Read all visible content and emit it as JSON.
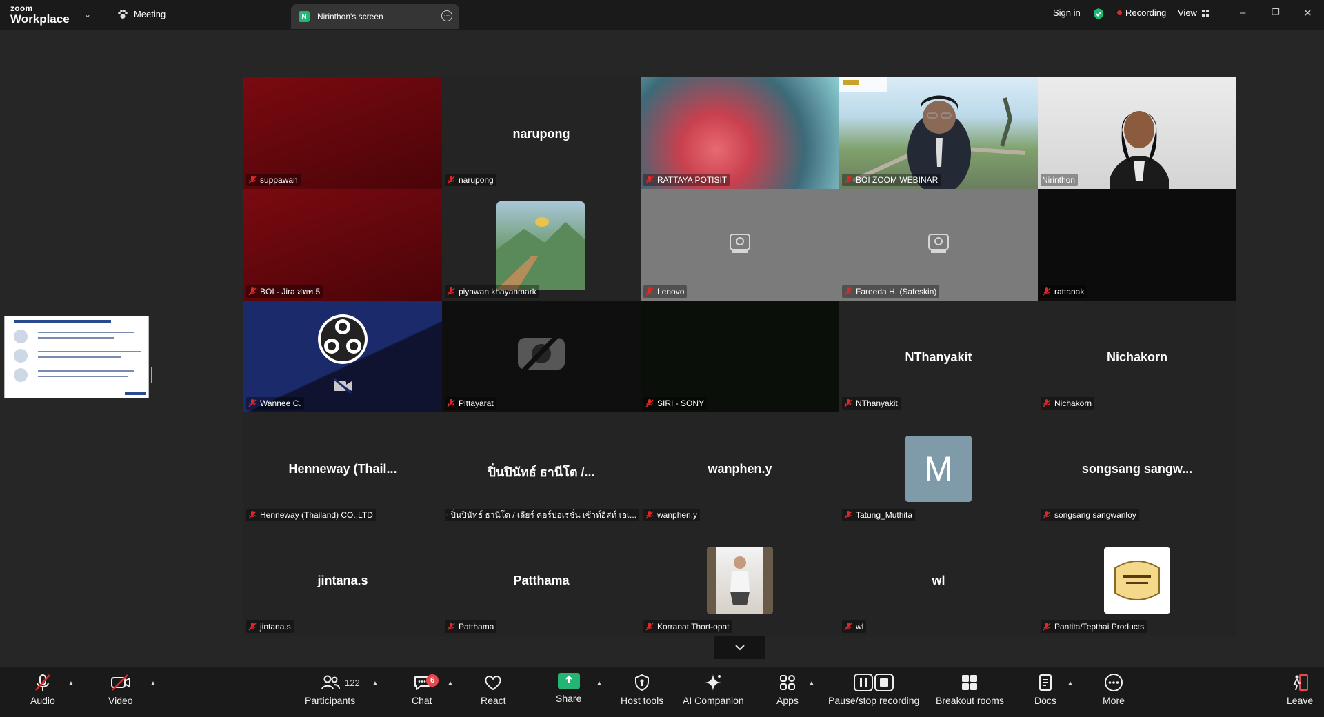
{
  "titlebar": {
    "logo_top": "zoom",
    "logo_bottom": "Workplace",
    "meeting_label": "Meeting",
    "screen_badge": "N",
    "screen_tab": "Nirinthon's screen",
    "signin": "Sign in",
    "recording": "Recording",
    "view": "View"
  },
  "gallery": {
    "tiles": [
      {
        "label": "suppawan",
        "center": ""
      },
      {
        "label": "narupong",
        "center": "narupong"
      },
      {
        "label": "RATTAYA POTISIT",
        "center": ""
      },
      {
        "label": "BOI ZOOM WEBINAR",
        "center": ""
      },
      {
        "label": "Nirinthon",
        "center": ""
      },
      {
        "label": "BOI - Jira สทท.5",
        "center": ""
      },
      {
        "label": "piyawan khayanmark",
        "center": ""
      },
      {
        "label": "Lenovo",
        "center": ""
      },
      {
        "label": "Fareeda H. (Safeskin)",
        "center": ""
      },
      {
        "label": "rattanak",
        "center": ""
      },
      {
        "label": "Wannee C.",
        "center": ""
      },
      {
        "label": "Pittayarat",
        "center": ""
      },
      {
        "label": "SIRI - SONY",
        "center": ""
      },
      {
        "label": "NThanyakit",
        "center": "NThanyakit"
      },
      {
        "label": "Nichakorn",
        "center": "Nichakorn"
      },
      {
        "label": "Henneway (Thailand) CO.,LTD",
        "center": "Henneway (Thail..."
      },
      {
        "label": "ปิ่นปินัทธ์ ธานีโต / เลียร์ คอร์ปอเรชั่น เซ้าท์อีสท์ เอเ...",
        "center": "ปิ่นปินัทธ์ ธานีโต /..."
      },
      {
        "label": "wanphen.y",
        "center": "wanphen.y"
      },
      {
        "label": "Tatung_Muthita",
        "center": "",
        "avatar_letter": "M"
      },
      {
        "label": "songsang sangwanloy",
        "center": "songsang sangw..."
      },
      {
        "label": "jintana.s",
        "center": "jintana.s"
      },
      {
        "label": "Patthama",
        "center": "Patthama"
      },
      {
        "label": "Korranat Thort-opat",
        "center": ""
      },
      {
        "label": "wl",
        "center": "wl"
      },
      {
        "label": "Pantita/Tepthai Products",
        "center": ""
      }
    ]
  },
  "toolbar": {
    "audio": "Audio",
    "video": "Video",
    "participants": "Participants",
    "participants_count": "122",
    "chat": "Chat",
    "chat_badge": "6",
    "react": "React",
    "share": "Share",
    "host_tools": "Host tools",
    "ai_companion": "AI Companion",
    "apps": "Apps",
    "pause_stop": "Pause/stop recording",
    "breakout": "Breakout rooms",
    "docs": "Docs",
    "more": "More",
    "leave": "Leave"
  },
  "colors": {
    "active_speaker": "#3ddc84",
    "mute_red": "#e02828",
    "share_green": "#22b573"
  }
}
